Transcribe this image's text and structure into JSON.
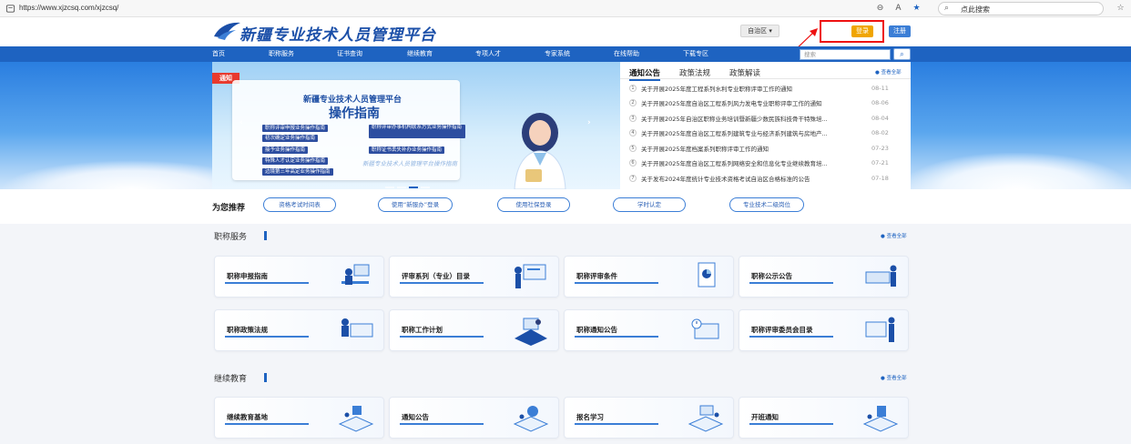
{
  "browser": {
    "url": "https://www.xjzcsq.com/xjzcsq/",
    "search_placeholder": "点此搜索"
  },
  "site": {
    "logo_text": "新疆专业技术人员管理平台",
    "region": "自治区",
    "login_label": "登录",
    "register_label": "注册",
    "search_placeholder": "搜索"
  },
  "nav": {
    "items": [
      "首页",
      "职称服务",
      "证书查询",
      "继续教育",
      "专项人才",
      "专家系统",
      "在线帮助",
      "下载专区"
    ]
  },
  "banner": {
    "tag": "通知",
    "title1": "新疆专业技术人员管理平台",
    "title2": "操作指南",
    "chips": [
      "职称评审申报业务操作指南",
      "初次确定业务操作指南",
      "接予业务操作指南",
      "特殊人才认定业务操作指南",
      "边境第三年高定业务操作指南",
      "职称评审办事机构联系方式业务操作指南",
      "职称证书丢失补办业务操作指南"
    ],
    "slogan": "新疆专业技术人员管理平台操作指南"
  },
  "notice": {
    "tabs": [
      "通知公告",
      "政策法规",
      "政策解读"
    ],
    "more": "查看全部",
    "items": [
      {
        "num": "1",
        "text": "关于开展2025年度工程系列水利专业职称评审工作的通知",
        "date": "08-11"
      },
      {
        "num": "2",
        "text": "关于开展2025年度自治区工程系列风力发电专业职称评审工作的通知",
        "date": "08-06"
      },
      {
        "num": "3",
        "text": "关于开展2025年自治区职称业务培训暨新疆少数民族科技骨干特殊培...",
        "date": "08-04"
      },
      {
        "num": "4",
        "text": "关于开展2025年度自治区工程系列建筑专业与经济系列建筑与房地产...",
        "date": "08-02"
      },
      {
        "num": "5",
        "text": "关于开展2025年度档案系列职称评审工作的通知",
        "date": "07-23"
      },
      {
        "num": "6",
        "text": "关于开展2025年度自治区工程系列网络安全和信息化专业继续教育培...",
        "date": "07-21"
      },
      {
        "num": "7",
        "text": "关于发布2024年度统计专业技术资格考试自治区合格标准的公告",
        "date": "07-18"
      }
    ]
  },
  "recommend": {
    "title": "为您推荐",
    "buttons": [
      "资格考试时间表",
      "使用“新服办”登录",
      "使用社保登录",
      "学时认定",
      "专业技术二级岗位"
    ]
  },
  "title_service": {
    "title": "职称服务",
    "more": "查看全部",
    "cards": [
      "职称申报指南",
      "评审系列（专业）目录",
      "职称评审条件",
      "职称公示公告",
      "职称政策法规",
      "职称工作计划",
      "职称通知公告",
      "职称评审委员会目录"
    ]
  },
  "continuing_edu": {
    "title": "继续教育",
    "more": "查看全部",
    "cards": [
      "继续教育基地",
      "通知公告",
      "报名学习",
      "开班通知"
    ]
  },
  "colors": {
    "brand_blue": "#1e63c1",
    "login_orange": "#f0a500",
    "annotation_red": "#e11111"
  }
}
